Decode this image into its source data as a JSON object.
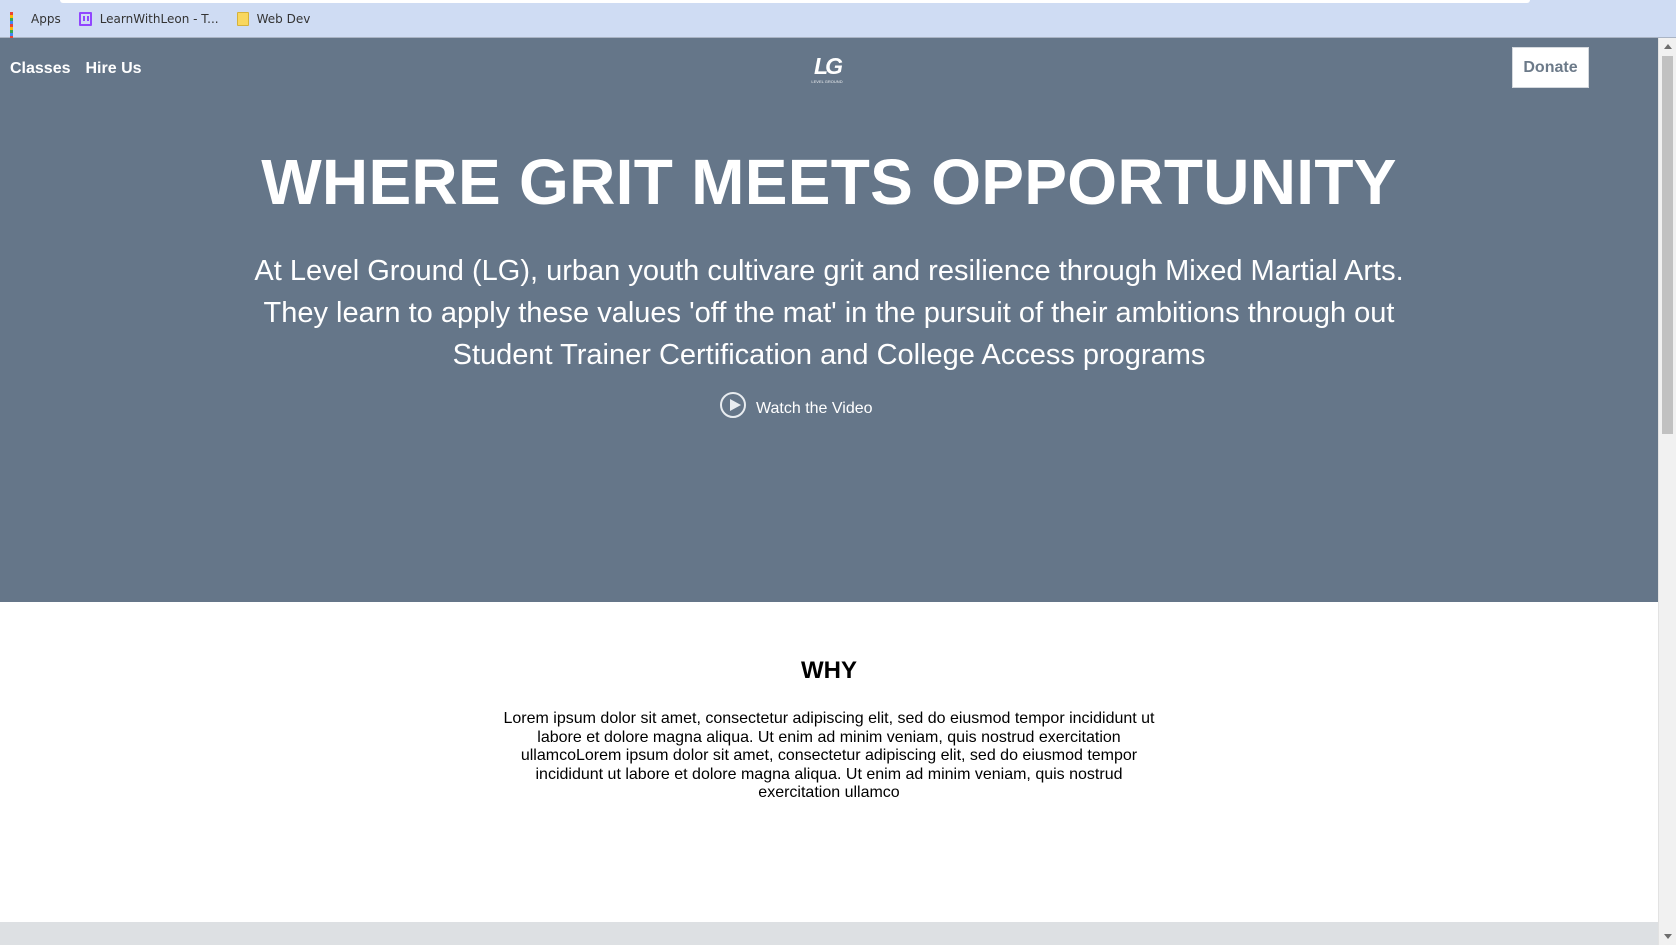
{
  "browser": {
    "bookmarks": [
      {
        "label": "Apps",
        "icon": "apps-grid-icon"
      },
      {
        "label": "LearnWithLeon - T...",
        "icon": "twitch-icon"
      },
      {
        "label": "Web Dev",
        "icon": "folder-icon"
      }
    ]
  },
  "nav": {
    "links": [
      "Classes",
      "Hire Us"
    ],
    "logo_mark": "LG",
    "logo_sub": "LEVEL GROUND",
    "donate_label": "Donate"
  },
  "hero": {
    "title": "WHERE GRIT MEETS OPPORTUNITY",
    "description": "At Level Ground (LG), urban youth cultivare grit and resilience through Mixed Martial Arts. They learn to apply these values 'off the mat' in the pursuit of their ambitions through out Student Trainer Certification and College Access programs",
    "video_label": "Watch the Video",
    "video_icon": "play-circle-icon"
  },
  "why": {
    "title": "WHY",
    "text": "Lorem ipsum dolor sit amet, consectetur adipiscing elit, sed do eiusmod tempor incididunt ut labore et dolore magna aliqua. Ut enim ad minim veniam, quis nostrud exercitation ullamcoLorem ipsum dolor sit amet, consectetur adipiscing elit, sed do eiusmod tempor incididunt ut labore et dolore magna aliqua. Ut enim ad minim veniam, quis nostrud exercitation ullamco"
  },
  "colors": {
    "hero_bg": "#657689",
    "bookmarks_bar_bg": "#cfdcf3",
    "donate_text": "#6c7a89",
    "footer_strip": "#dde0e3"
  }
}
